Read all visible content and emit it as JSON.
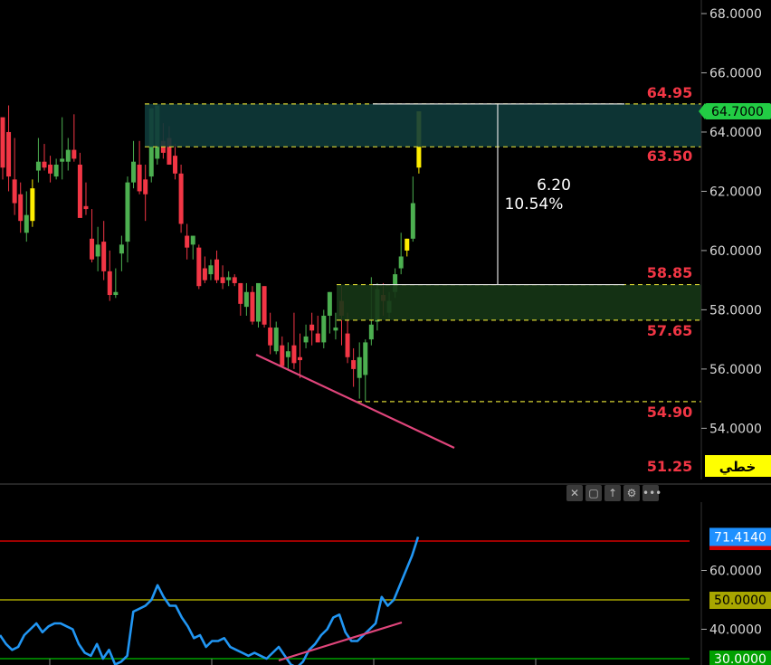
{
  "window": {
    "scale_tag_label": "خطي"
  },
  "price_axis": {
    "ticks": [
      "68.0000",
      "66.0000",
      "64.0000",
      "62.0000",
      "60.0000",
      "58.0000",
      "56.0000",
      "54.0000"
    ],
    "current_price_label": "64.7000",
    "current_price": 64.7,
    "current_price_color": "#22cc44"
  },
  "indicator_axis": {
    "ticks": [
      "60.0000",
      "40.0000"
    ],
    "current_label": "71.4140",
    "current_value": 71.414,
    "current_color": "#1e90ff",
    "levels": [
      {
        "label": "70.0000",
        "value": 70,
        "color": "#d10000",
        "text_color": "#ffffff"
      },
      {
        "label": "50.0000",
        "value": 50,
        "color": "#a8a600",
        "text_color": "#000000"
      },
      {
        "label": "30.0000",
        "value": 30,
        "color": "#00a000",
        "text_color": "#ffffff"
      }
    ]
  },
  "annotations": {
    "measure_diff": "6.20",
    "measure_pct": "10.54%",
    "levels": [
      {
        "label": "64.95",
        "value": 64.95
      },
      {
        "label": "63.50",
        "value": 63.5
      },
      {
        "label": "58.85",
        "value": 58.85
      },
      {
        "label": "57.65",
        "value": 57.65
      },
      {
        "label": "54.90",
        "value": 54.9
      },
      {
        "label": "51.25",
        "value": 51.25
      }
    ],
    "zone_colors": {
      "upper": "#0e3a3a",
      "lower": "#163616"
    }
  },
  "toolbar": {
    "icons": [
      "close-icon",
      "window-icon",
      "arrow-up-icon",
      "settings-icon",
      "more-icon"
    ]
  },
  "chart_data": [
    {
      "type": "candlestick",
      "title": "",
      "ylim": [
        52.0,
        69.0
      ],
      "candles": [
        [
          64.5,
          64.3,
          62.4,
          62.8,
          "red"
        ],
        [
          64.0,
          64.9,
          62.0,
          62.5,
          "red"
        ],
        [
          62.4,
          63.8,
          61.2,
          61.6,
          "red"
        ],
        [
          61.9,
          62.3,
          60.6,
          61.0,
          "red"
        ],
        [
          61.2,
          62.0,
          60.3,
          60.6,
          "green"
        ],
        [
          61.0,
          62.4,
          60.8,
          62.1,
          "yellow"
        ],
        [
          62.7,
          63.8,
          62.3,
          63.0,
          "green"
        ],
        [
          63.0,
          63.6,
          62.7,
          62.8,
          "red"
        ],
        [
          62.9,
          63.2,
          62.3,
          62.6,
          "red"
        ],
        [
          62.5,
          63.1,
          62.4,
          62.9,
          "green"
        ],
        [
          63.0,
          64.5,
          62.4,
          63.1,
          "green"
        ],
        [
          63.0,
          63.8,
          62.7,
          63.4,
          "green"
        ],
        [
          63.4,
          64.6,
          63.0,
          63.1,
          "red"
        ],
        [
          62.9,
          63.3,
          61.3,
          61.1,
          "red"
        ],
        [
          61.5,
          62.3,
          61.2,
          61.4,
          "red"
        ],
        [
          60.4,
          61.4,
          59.6,
          59.7,
          "red"
        ],
        [
          59.8,
          60.8,
          59.3,
          60.2,
          "green"
        ],
        [
          60.3,
          61.0,
          59.0,
          59.3,
          "red"
        ],
        [
          59.3,
          60.0,
          58.3,
          58.5,
          "red"
        ],
        [
          58.5,
          59.4,
          58.4,
          58.6,
          "green"
        ],
        [
          59.9,
          60.5,
          59.3,
          60.2,
          "green"
        ],
        [
          60.3,
          62.5,
          59.6,
          62.3,
          "green"
        ],
        [
          62.3,
          63.7,
          62.1,
          63.0,
          "green"
        ],
        [
          62.9,
          63.7,
          61.9,
          62.0,
          "red"
        ],
        [
          61.9,
          62.9,
          61.0,
          62.4,
          "red"
        ],
        [
          62.5,
          64.8,
          62.3,
          64.8,
          "green"
        ],
        [
          64.9,
          64.8,
          62.9,
          63.1,
          "green"
        ],
        [
          63.7,
          64.3,
          63.1,
          63.3,
          "red"
        ],
        [
          63.8,
          64.2,
          62.9,
          62.9,
          "red"
        ],
        [
          63.2,
          63.6,
          62.4,
          62.6,
          "red"
        ],
        [
          62.6,
          62.9,
          60.6,
          60.9,
          "red"
        ],
        [
          60.5,
          60.9,
          59.7,
          60.1,
          "red"
        ],
        [
          60.5,
          60.5,
          59.7,
          60.2,
          "green"
        ],
        [
          60.1,
          60.2,
          58.7,
          58.8,
          "red"
        ],
        [
          59.4,
          59.8,
          58.9,
          59.0,
          "red"
        ],
        [
          59.2,
          59.7,
          59.0,
          59.5,
          "green"
        ],
        [
          59.7,
          60.0,
          58.9,
          59.0,
          "red"
        ],
        [
          59.1,
          59.5,
          58.7,
          58.9,
          "red"
        ],
        [
          59.1,
          59.3,
          58.8,
          59.0,
          "green"
        ],
        [
          59.1,
          59.2,
          58.8,
          58.9,
          "red"
        ],
        [
          58.9,
          58.9,
          57.8,
          58.2,
          "red"
        ],
        [
          58.1,
          58.9,
          57.8,
          58.6,
          "green"
        ],
        [
          58.6,
          58.8,
          57.5,
          57.6,
          "red"
        ],
        [
          57.6,
          58.8,
          57.4,
          58.9,
          "green"
        ],
        [
          58.8,
          58.8,
          57.4,
          57.5,
          "red"
        ],
        [
          57.4,
          57.9,
          56.5,
          56.8,
          "red"
        ],
        [
          56.6,
          57.6,
          56.5,
          57.4,
          "green"
        ],
        [
          56.8,
          57.1,
          56.3,
          56.1,
          "red"
        ],
        [
          56.4,
          56.9,
          56.0,
          56.6,
          "green"
        ],
        [
          56.8,
          57.9,
          56.0,
          56.2,
          "red"
        ],
        [
          56.4,
          57.2,
          55.7,
          56.3,
          "red"
        ],
        [
          56.9,
          57.5,
          56.7,
          57.1,
          "green"
        ],
        [
          57.3,
          57.9,
          56.8,
          57.5,
          "red"
        ],
        [
          57.2,
          57.8,
          56.9,
          56.9,
          "red"
        ],
        [
          56.9,
          58.0,
          56.7,
          57.8,
          "green"
        ],
        [
          57.8,
          58.6,
          57.2,
          58.6,
          "green"
        ],
        [
          57.3,
          57.9,
          57.0,
          57.4,
          "green"
        ],
        [
          58.3,
          58.8,
          56.8,
          57.8,
          "red"
        ],
        [
          57.2,
          57.9,
          56.2,
          56.4,
          "red"
        ],
        [
          56.3,
          56.7,
          55.4,
          56.0,
          "red"
        ],
        [
          56.4,
          56.9,
          55.0,
          55.7,
          "green"
        ],
        [
          55.8,
          57.0,
          54.9,
          56.9,
          "green"
        ],
        [
          57.0,
          59.1,
          56.8,
          57.5,
          "green"
        ],
        [
          57.6,
          58.9,
          57.3,
          58.7,
          "green"
        ],
        [
          58.5,
          58.9,
          57.8,
          58.3,
          "red"
        ],
        [
          57.9,
          58.6,
          57.7,
          58.3,
          "green"
        ],
        [
          58.6,
          59.4,
          58.4,
          59.2,
          "green"
        ],
        [
          59.4,
          60.6,
          59.2,
          59.8,
          "green"
        ],
        [
          60.0,
          60.4,
          59.8,
          60.4,
          "yellow"
        ],
        [
          60.4,
          62.5,
          60.3,
          61.6,
          "green"
        ],
        [
          62.8,
          64.7,
          62.6,
          64.7,
          "yellow"
        ]
      ]
    },
    {
      "type": "line",
      "title": "",
      "ylim": [
        24.0,
        80.0
      ],
      "series": [
        {
          "values": [
            38,
            35,
            33,
            34,
            38,
            40,
            42,
            39,
            41,
            42,
            42,
            41,
            40,
            35,
            32,
            31,
            35,
            30,
            33,
            28,
            29,
            31,
            46,
            47,
            48,
            50,
            55,
            51,
            48,
            48,
            44,
            41,
            37,
            38,
            34,
            36,
            36,
            37,
            34,
            33,
            32,
            31,
            32,
            31,
            30,
            32,
            34,
            31,
            28,
            27,
            29,
            33,
            35,
            38,
            40,
            44,
            45,
            39,
            36,
            36,
            38,
            40,
            42,
            51,
            48,
            50,
            55,
            60,
            65,
            71.4
          ]
        }
      ]
    }
  ]
}
